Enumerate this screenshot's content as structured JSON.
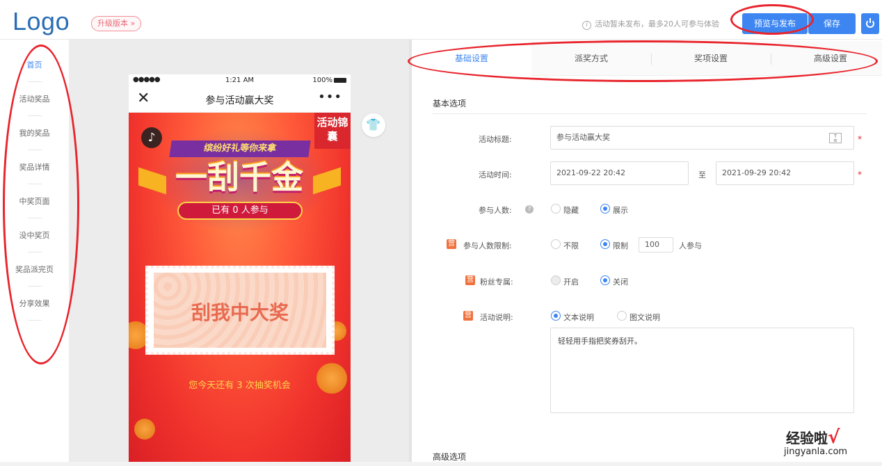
{
  "header": {
    "logo": "Logo",
    "upgrade_label": "升级版本 »",
    "notice": "活动暂未发布，最多20人可参与体验",
    "publish_label": "预览与发布",
    "save_label": "保存",
    "info_icon": "i"
  },
  "sidebar": {
    "items": [
      {
        "label": "首页"
      },
      {
        "label": "活动奖品"
      },
      {
        "label": "我的奖品"
      },
      {
        "label": "奖品详情"
      },
      {
        "label": "中奖页面"
      },
      {
        "label": "没中奖页"
      },
      {
        "label": "奖品派完页"
      },
      {
        "label": "分享效果"
      }
    ]
  },
  "phone": {
    "signal": "●●●●●",
    "time": "1:21 AM",
    "battery": "100%",
    "close": "✕",
    "title": "参与活动赢大奖",
    "more": "•••",
    "music_icon": "♪",
    "tag": "活动锦囊",
    "ribbon": "缤纷好礼等你来拿",
    "headline": "一刮千金",
    "joined": "已有 0 人参与",
    "scratch_text": "刮我中大奖",
    "chances": "您今天还有 3 次抽奖机会"
  },
  "tabs": [
    {
      "label": "基础设置"
    },
    {
      "label": "派奖方式"
    },
    {
      "label": "奖项设置"
    },
    {
      "label": "高级设置"
    }
  ],
  "form": {
    "section_basic": "基本选项",
    "section_advanced": "高级选项",
    "title_label": "活动标题:",
    "title_value": "参与活动赢大奖",
    "time_label": "活动时间:",
    "time_start": "2021-09-22 20:42",
    "time_to": "至",
    "time_end": "2021-09-29 20:42",
    "count_label": "参与人数:",
    "count_hide": "隐藏",
    "count_show": "展示",
    "limit_label": "参与人数限制:",
    "limit_none": "不限",
    "limit_yes": "限制",
    "limit_value": "100",
    "limit_unit": "人参与",
    "fans_label": "粉丝专属:",
    "fans_on": "开启",
    "fans_off": "关闭",
    "desc_label": "活动说明:",
    "desc_text_opt": "文本说明",
    "desc_rich_opt": "图文说明",
    "desc_value": "轻轻用手指把奖券刮开。",
    "ying": "营",
    "req": "*",
    "help": "?"
  },
  "watermark": {
    "text": "经验啦",
    "check": "√",
    "sub": "jingyanla.com"
  },
  "colors": {
    "accent": "#3d86f2",
    "annotation": "#e8242c"
  }
}
